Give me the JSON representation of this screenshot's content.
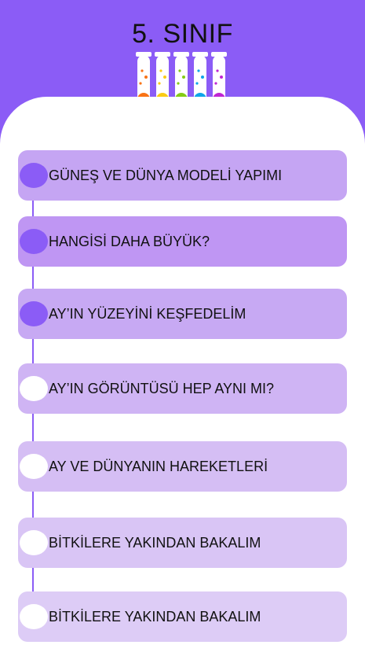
{
  "header": {
    "title": "5. SINIF",
    "icon": "test-tubes-icon",
    "background_color": "#8b5cf6"
  },
  "tube_colors": [
    "#f97316",
    "#facc15",
    "#84cc16",
    "#0ea5e9",
    "#c026d3"
  ],
  "lessons": [
    {
      "label": "GÜNEŞ VE DÜNYA MODELİ YAPIMI",
      "status": "completed",
      "card_color": "#c5a5f3",
      "dot_color": "#8b5cf6"
    },
    {
      "label": "HANGİSİ DAHA BÜYÜK?",
      "status": "completed",
      "card_color": "#bf96f3",
      "dot_color": "#8b5cf6"
    },
    {
      "label": "AY’IN YÜZEYİNİ KEŞFEDELİM",
      "status": "completed",
      "card_color": "#c7a9f3",
      "dot_color": "#8b5cf6"
    },
    {
      "label": "AY’IN GÖRÜNTÜSÜ HEP AYNI MI?",
      "status": "pending",
      "card_color": "#cfb4f4",
      "dot_color": "#ffffff"
    },
    {
      "label": "AY VE DÜNYANIN HAREKETLERİ",
      "status": "pending",
      "card_color": "#d5bef4",
      "dot_color": "#ffffff"
    },
    {
      "label": "BİTKİLERE YAKINDAN BAKALIM",
      "status": "pending",
      "card_color": "#d9c5f5",
      "dot_color": "#ffffff"
    },
    {
      "label": "BİTKİLERE YAKINDAN BAKALIM",
      "status": "pending",
      "card_color": "#ddccf6",
      "dot_color": "#ffffff"
    }
  ]
}
